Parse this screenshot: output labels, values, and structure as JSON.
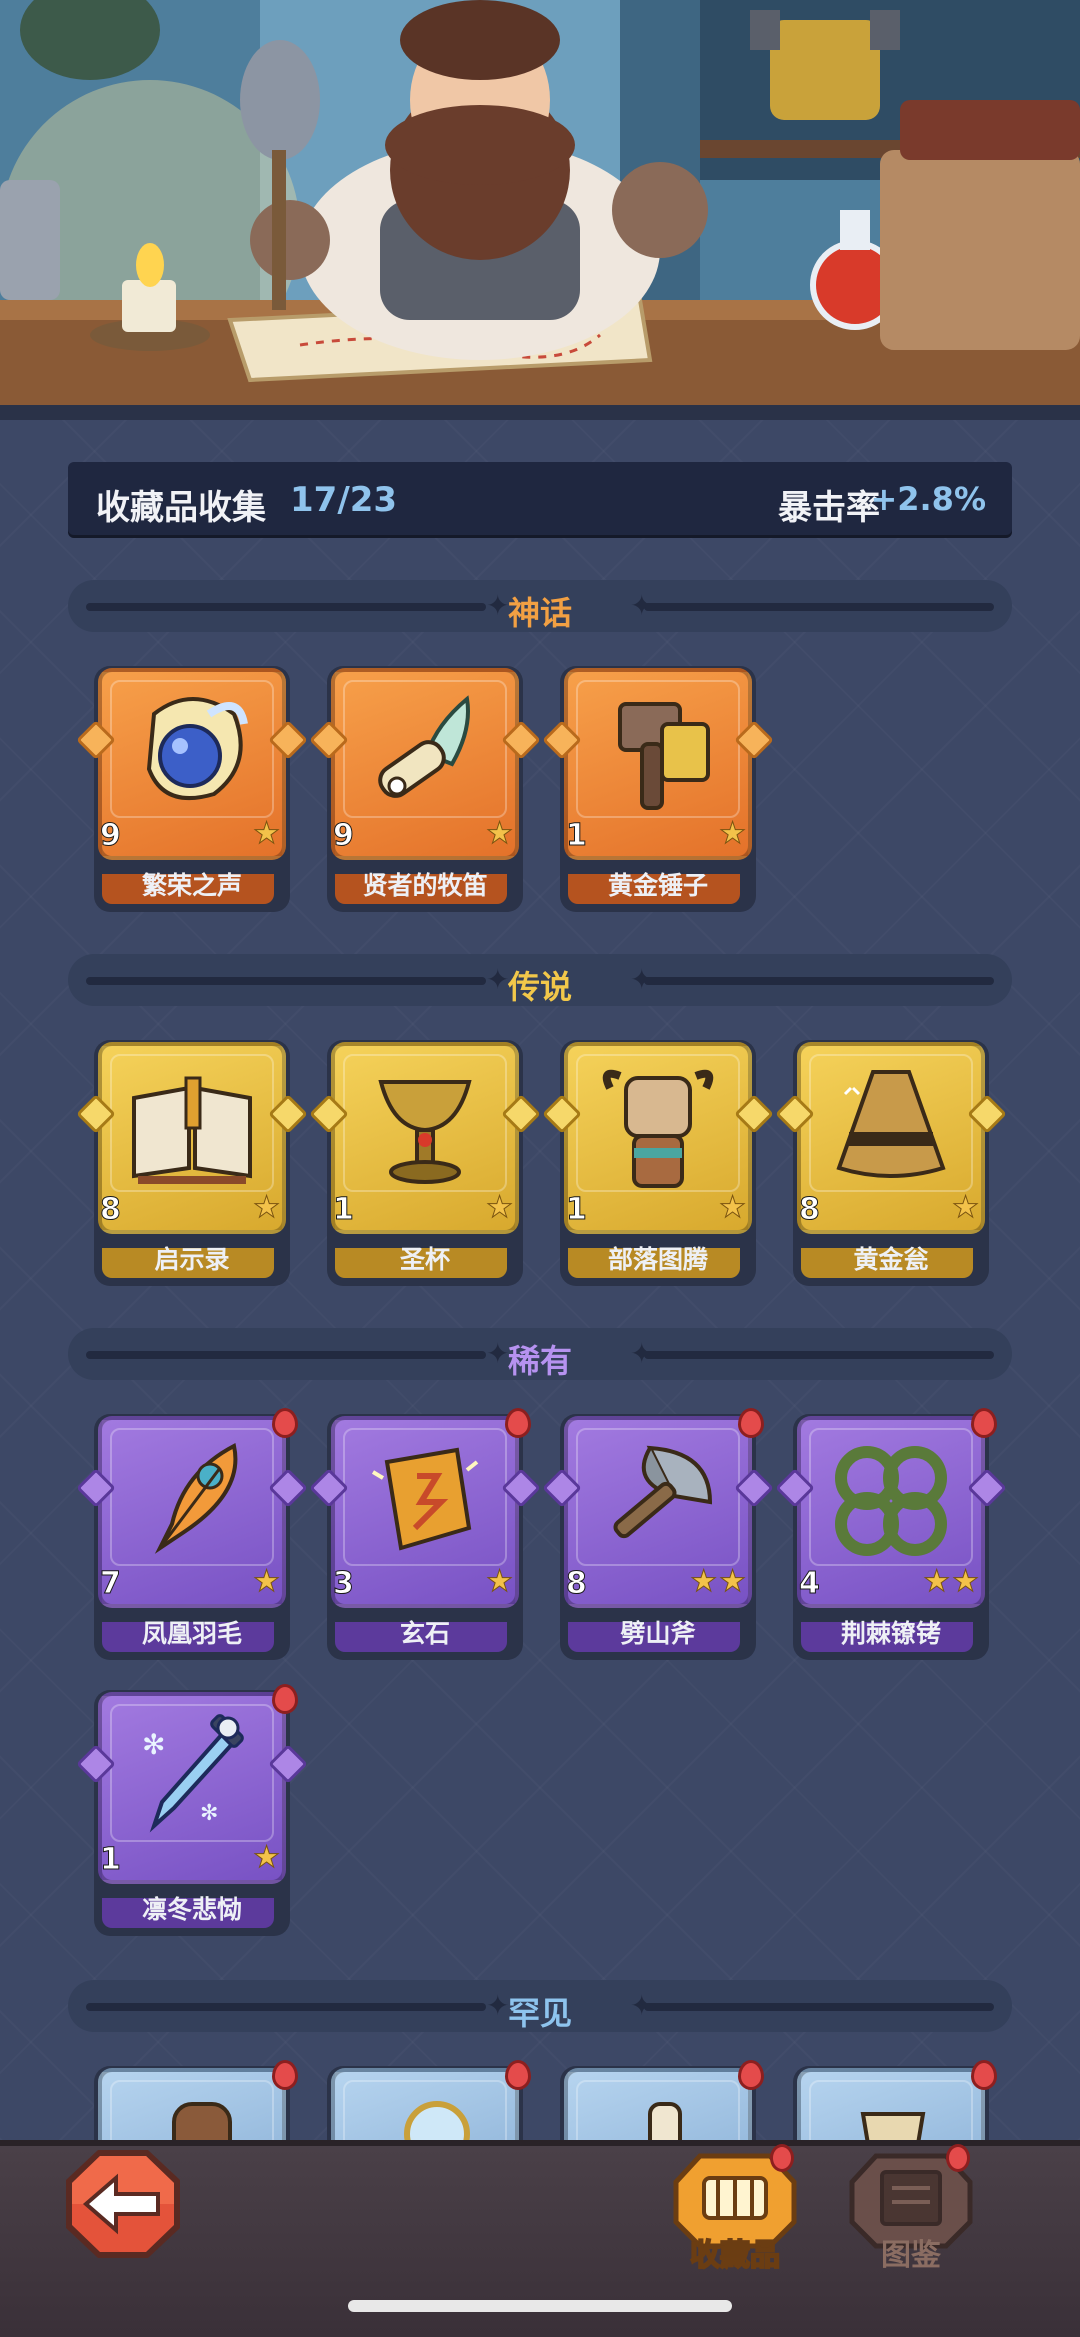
{
  "summary": {
    "title": "收藏品收集",
    "count": "17/23",
    "crit_label": "暴击率",
    "crit_value": "+2.8%"
  },
  "sections": {
    "mythic": {
      "label": "神话",
      "items": [
        {
          "name": "繁荣之声",
          "level": "9",
          "stars": 1,
          "icon": "orb-icon"
        },
        {
          "name": "贤者的牧笛",
          "level": "9",
          "stars": 1,
          "icon": "flute-icon"
        },
        {
          "name": "黄金锤子",
          "level": "1",
          "stars": 1,
          "icon": "hammer-icon"
        }
      ]
    },
    "legend": {
      "label": "传说",
      "items": [
        {
          "name": "启示录",
          "level": "8",
          "stars": 1,
          "icon": "book-icon"
        },
        {
          "name": "圣杯",
          "level": "1",
          "stars": 1,
          "icon": "chalice-icon"
        },
        {
          "name": "部落图腾",
          "level": "1",
          "stars": 1,
          "icon": "totem-icon"
        },
        {
          "name": "黄金瓮",
          "level": "8",
          "stars": 1,
          "icon": "urn-icon"
        }
      ]
    },
    "rare": {
      "label": "稀有",
      "items": [
        {
          "name": "凤凰羽毛",
          "level": "7",
          "stars": 1,
          "icon": "feather-icon"
        },
        {
          "name": "玄石",
          "level": "3",
          "stars": 1,
          "icon": "rune-stone-icon"
        },
        {
          "name": "劈山斧",
          "level": "8",
          "stars": 2,
          "icon": "axe-icon"
        },
        {
          "name": "荆棘镣铐",
          "level": "4",
          "stars": 2,
          "icon": "thorn-shackles-icon"
        },
        {
          "name": "凛冬悲恸",
          "level": "1",
          "stars": 1,
          "icon": "frost-sword-icon"
        }
      ]
    },
    "uncommon": {
      "label": "罕见"
    }
  },
  "nav": {
    "collectibles": "收藏品",
    "codex": "图鉴"
  },
  "colors": {
    "mythic": "#f2a043",
    "legend": "#f2c84a",
    "rare": "#b692f0",
    "uncommon": "#8ec4ee"
  }
}
